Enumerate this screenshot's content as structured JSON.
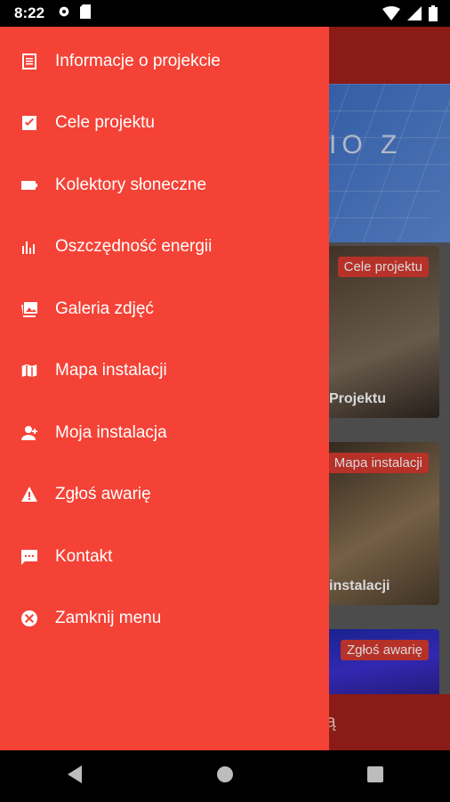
{
  "status_bar": {
    "time": "8:22"
  },
  "background": {
    "hero_text": "IO Z",
    "cards": [
      {
        "tag": "Cele projektu",
        "caption": "Projektu"
      },
      {
        "tag": "Mapa instalacji",
        "caption": "instalacji"
      },
      {
        "tag": "Zgłoś awarię",
        "caption": ""
      }
    ],
    "bottom_text": "ią"
  },
  "drawer": {
    "items": [
      {
        "label": "Informacje o projekcie",
        "icon": "document-icon"
      },
      {
        "label": "Cele projektu",
        "icon": "checkbox-icon"
      },
      {
        "label": "Kolektory słoneczne",
        "icon": "battery-icon"
      },
      {
        "label": "Oszczędność energii",
        "icon": "bar-chart-icon"
      },
      {
        "label": "Galeria zdjęć",
        "icon": "gallery-icon"
      },
      {
        "label": "Mapa instalacji",
        "icon": "map-icon"
      },
      {
        "label": "Moja instalacja",
        "icon": "add-person-icon"
      },
      {
        "label": "Zgłoś awarię",
        "icon": "warning-icon"
      },
      {
        "label": "Kontakt",
        "icon": "chat-icon"
      },
      {
        "label": "Zamknij menu",
        "icon": "close-circle-icon"
      }
    ]
  },
  "colors": {
    "drawer": "#f44236",
    "appbar": "#a3201b",
    "tag": "#d63a2f"
  }
}
